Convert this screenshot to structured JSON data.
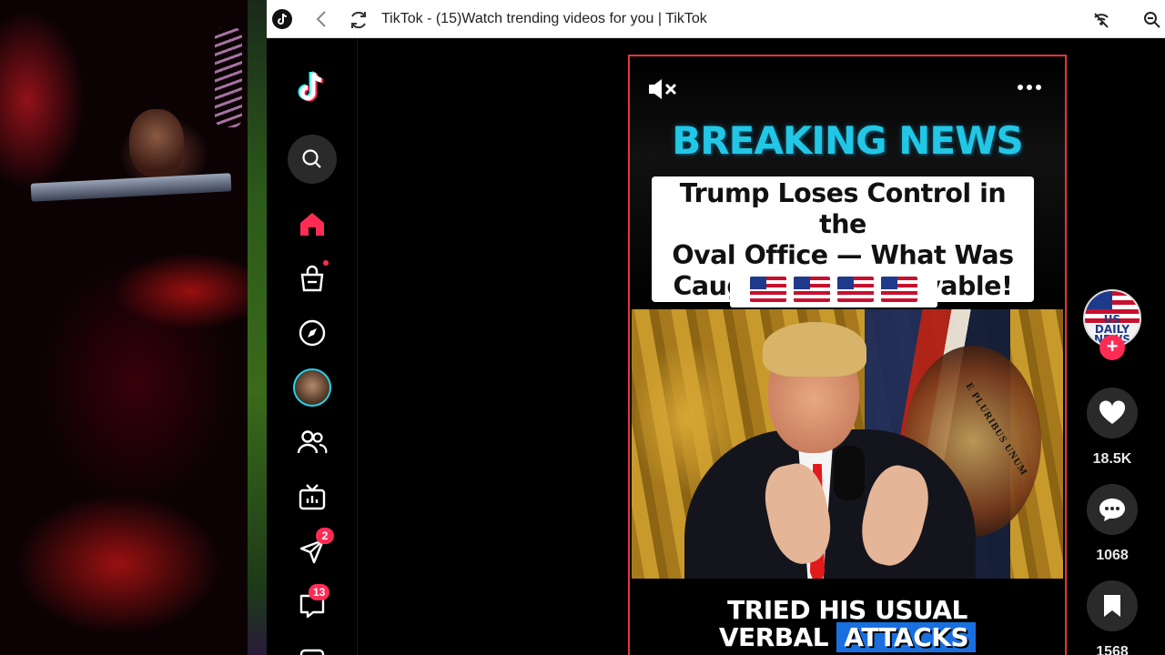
{
  "browser": {
    "title": "TikTok - (15)Watch trending videos for you | TikTok"
  },
  "sidebar": {
    "inbox_badge": "2",
    "messages_badge": "13"
  },
  "video": {
    "banner": "BREAKING NEWS",
    "headline_lines": [
      "Trump Loses Control in the",
      "Oval Office — What Was",
      "Caught Is Unbelievable!"
    ],
    "flags": [
      "🇺🇸",
      "🇺🇸",
      "🇺🇸",
      "🇺🇸"
    ],
    "seal_text": "E PLURIBUS UNUM",
    "caption_line1": "TRIED HIS USUAL",
    "caption_line2a": "VERBAL",
    "caption_line2b": "ATTACKS"
  },
  "rail": {
    "avatar_text": "US DAILY NEWS",
    "likes": "18.5K",
    "comments": "1068",
    "saves": "1568"
  },
  "colors": {
    "accent": "#fe2c55",
    "breaking": "#22c7e6",
    "caption_highlight": "#1a6fe0",
    "video_border": "#e6353a"
  }
}
